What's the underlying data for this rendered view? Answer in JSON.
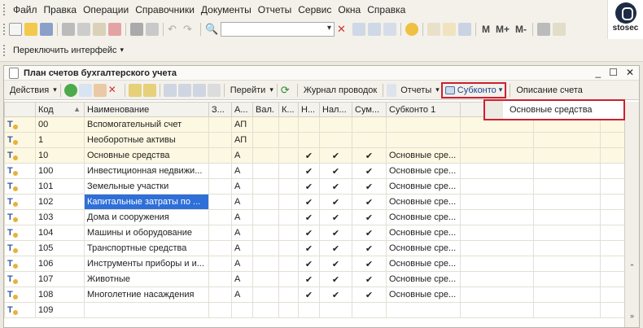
{
  "menubar": {
    "items": [
      "Файл",
      "Правка",
      "Операции",
      "Справочники",
      "Документы",
      "Отчеты",
      "Сервис",
      "Окна",
      "Справка"
    ]
  },
  "logo": {
    "text": "stosec"
  },
  "toolbar": {
    "m_plus": "M",
    "m": "M+",
    "m_minus": "M-"
  },
  "toolbar2": {
    "switch_interface": "Переключить интерфейс"
  },
  "window": {
    "title": "План счетов бухгалтерского учета",
    "minimize": "_",
    "maximize": "☐",
    "close": "✕"
  },
  "actions": {
    "actions_label": "Действия",
    "goto_label": "Перейти",
    "journal_label": "Журнал проводок",
    "reports_label": "Отчеты",
    "subkonto_label": "Субконто",
    "description_label": "Описание счета"
  },
  "dropdown": {
    "option": "Основные средства"
  },
  "columns": [
    "",
    "Код",
    "Наименование",
    "З...",
    "А...",
    "Вал.",
    "К...",
    "Н...",
    "Нал...",
    "Сум...",
    "Субконто 1",
    "",
    "",
    ""
  ],
  "rows": [
    {
      "code": "00",
      "name": "Вспомогательный счет",
      "type": "АП",
      "n": "",
      "nal": "",
      "sum": "",
      "sub1": ""
    },
    {
      "code": "1",
      "name": "Необоротные активы",
      "type": "АП",
      "n": "",
      "nal": "",
      "sum": "",
      "sub1": ""
    },
    {
      "code": "10",
      "name": "Основные средства",
      "type": "А",
      "n": "✔",
      "nal": "✔",
      "sum": "✔",
      "sub1": "Основные сре..."
    },
    {
      "code": "100",
      "name": "Инвестиционная недвижи...",
      "type": "А",
      "n": "✔",
      "nal": "✔",
      "sum": "✔",
      "sub1": "Основные сре..."
    },
    {
      "code": "101",
      "name": "Земельные участки",
      "type": "А",
      "n": "✔",
      "nal": "✔",
      "sum": "✔",
      "sub1": "Основные сре..."
    },
    {
      "code": "102",
      "name": "Капитальные затраты по ...",
      "type": "А",
      "n": "✔",
      "nal": "✔",
      "sum": "✔",
      "sub1": "Основные сре..."
    },
    {
      "code": "103",
      "name": "Дома и сооружения",
      "type": "А",
      "n": "✔",
      "nal": "✔",
      "sum": "✔",
      "sub1": "Основные сре..."
    },
    {
      "code": "104",
      "name": "Машины и оборудование",
      "type": "А",
      "n": "✔",
      "nal": "✔",
      "sum": "✔",
      "sub1": "Основные сре..."
    },
    {
      "code": "105",
      "name": "Транспортные средства",
      "type": "А",
      "n": "✔",
      "nal": "✔",
      "sum": "✔",
      "sub1": "Основные сре..."
    },
    {
      "code": "106",
      "name": "Инструменты приборы и и...",
      "type": "А",
      "n": "✔",
      "nal": "✔",
      "sum": "✔",
      "sub1": "Основные сре..."
    },
    {
      "code": "107",
      "name": "Животные",
      "type": "А",
      "n": "✔",
      "nal": "✔",
      "sum": "✔",
      "sub1": "Основные сре..."
    },
    {
      "code": "108",
      "name": "Многолетние насаждения",
      "type": "А",
      "n": "✔",
      "nal": "✔",
      "sum": "✔",
      "sub1": "Основные сре..."
    },
    {
      "code": "109",
      "name": "",
      "type": "",
      "n": "",
      "nal": "",
      "sum": "",
      "sub1": ""
    }
  ]
}
